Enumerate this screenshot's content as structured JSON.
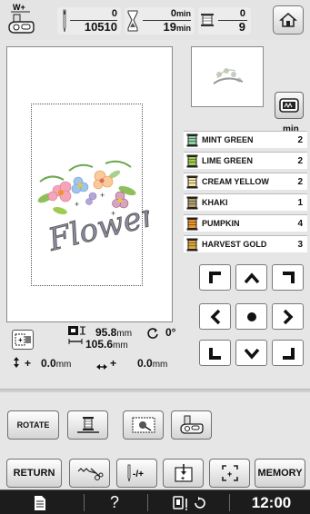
{
  "top": {
    "wplus_label": "W+",
    "stitch_current": "0",
    "stitch_total": "10510",
    "time_elapsed": "0",
    "time_total": "19",
    "time_unit": "min",
    "color_current": "0",
    "color_total": "9"
  },
  "colors": {
    "min_label": "min",
    "items": [
      {
        "name": "MINT GREEN",
        "time": "2",
        "color": "#8ecfa6"
      },
      {
        "name": "LIME GREEN",
        "time": "2",
        "color": "#9dcc50"
      },
      {
        "name": "CREAM YELLOW",
        "time": "2",
        "color": "#f0e2a0"
      },
      {
        "name": "KHAKI",
        "time": "1",
        "color": "#b5a06a"
      },
      {
        "name": "PUMPKIN",
        "time": "4",
        "color": "#f0932b"
      },
      {
        "name": "HARVEST GOLD",
        "time": "3",
        "color": "#e0a83a"
      }
    ]
  },
  "info": {
    "height_value": "95.8",
    "width_value": "105.6",
    "unit": "mm",
    "angle": "0°",
    "vert_offset": "0.0",
    "horiz_offset": "0.0",
    "plus": "+",
    "plus2": "+"
  },
  "toolbar1": {
    "rotate_label": "ROTATE"
  },
  "toolbar2": {
    "return_label": "RETURN",
    "memory_label": "MEMORY"
  },
  "status": {
    "clock": "12:00",
    "help": "?"
  },
  "design": {
    "text": "Flower"
  }
}
